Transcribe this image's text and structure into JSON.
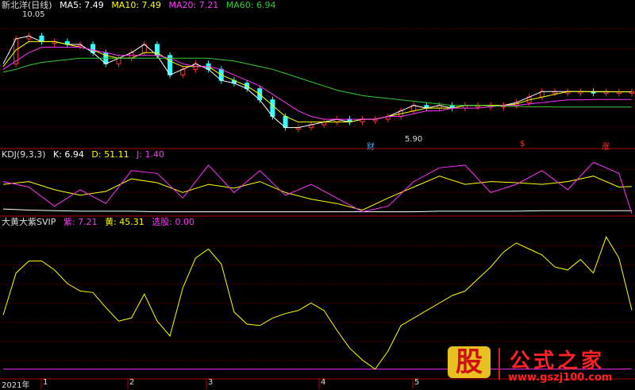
{
  "panels": {
    "main": {
      "title": "新北洋(日线)",
      "indicators": [
        {
          "label": "MA5: 7.49",
          "color": "#ffffff"
        },
        {
          "label": "MA10: 7.49",
          "color": "#ffff00"
        },
        {
          "label": "MA20: 7.21",
          "color": "#ff33ff"
        },
        {
          "label": "MA60: 6.94",
          "color": "#33cc33"
        }
      ],
      "high_label": "10.05",
      "low_label": "5.90",
      "events": [
        {
          "label": "财",
          "color": "#33aaff"
        },
        {
          "label": "$",
          "color": "#ff3333"
        },
        {
          "label": "涨",
          "color": "#ff3333"
        }
      ]
    },
    "kdj": {
      "title": "KDJ(9,3,3)",
      "indicators": [
        {
          "label": "K: 6.94",
          "color": "#ffffff"
        },
        {
          "label": "D: 51.11",
          "color": "#ffff00"
        },
        {
          "label": "J: 1.40",
          "color": "#ff33ff"
        }
      ]
    },
    "custom": {
      "title": "大黄大紫SVIP",
      "indicators": [
        {
          "label": "紫: 7.21",
          "color": "#ff33ff"
        },
        {
          "label": "黄: 45.31",
          "color": "#ffff00"
        },
        {
          "label": "选股: 0.00",
          "color": "#ff33ff"
        }
      ]
    }
  },
  "x_ticks": [
    "2021年",
    "1",
    "2",
    "3",
    "4",
    "5"
  ],
  "watermark": {
    "big": "股",
    "text": "公式之家",
    "url": "www.gszj100.com"
  },
  "colors": {
    "up": "#ff3333",
    "down": "#33ffff",
    "ma5": "#ffffff",
    "ma10": "#ffff00",
    "ma20": "#ff33ff",
    "ma60": "#33cc33",
    "sep": "#b00000",
    "grid": "#6a0000"
  },
  "chart_data": [
    {
      "type": "line",
      "panel": "main",
      "ylim": [
        5.5,
        10.4
      ],
      "x": [
        0,
        4,
        8,
        12,
        16,
        20,
        24,
        28,
        32,
        36,
        40,
        44,
        48,
        52,
        56,
        60,
        64,
        68,
        72,
        76,
        80,
        84,
        88,
        92,
        96,
        100,
        104,
        108,
        112,
        116,
        120,
        124,
        128,
        132,
        136,
        140,
        144,
        148,
        152,
        156,
        160,
        164,
        168,
        172,
        176,
        180,
        184,
        188,
        192,
        196
      ],
      "series": [
        {
          "name": "MA5",
          "values": [
            8.5,
            9.4,
            9.5,
            9.3,
            9.3,
            9.2,
            9.2,
            8.9,
            8.5,
            8.7,
            8.9,
            9.2,
            8.8,
            8.1,
            8.3,
            8.5,
            8.3,
            7.9,
            7.8,
            7.6,
            7.2,
            6.6,
            6.2,
            6.2,
            6.3,
            6.4,
            6.5,
            6.4,
            6.5,
            6.5,
            6.6,
            6.8,
            7.0,
            6.9,
            7.0,
            6.9,
            7.0,
            7.0,
            7.0,
            7.0,
            7.1,
            7.3,
            7.5,
            7.5,
            7.5,
            7.5,
            7.49,
            7.49,
            7.49,
            7.49
          ]
        },
        {
          "name": "MA10",
          "values": [
            8.4,
            9.0,
            9.3,
            9.3,
            9.3,
            9.2,
            9.1,
            9.0,
            8.8,
            8.7,
            8.7,
            8.9,
            8.9,
            8.6,
            8.4,
            8.4,
            8.4,
            8.1,
            7.9,
            7.7,
            7.4,
            7.0,
            6.6,
            6.4,
            6.4,
            6.4,
            6.4,
            6.4,
            6.5,
            6.5,
            6.6,
            6.7,
            6.8,
            6.9,
            6.9,
            6.9,
            7.0,
            7.0,
            7.0,
            7.0,
            7.05,
            7.2,
            7.3,
            7.4,
            7.5,
            7.5,
            7.5,
            7.5,
            7.49,
            7.49
          ]
        },
        {
          "name": "MA20",
          "values": [
            8.3,
            8.6,
            8.9,
            9.1,
            9.1,
            9.1,
            9.1,
            9.0,
            8.9,
            8.8,
            8.8,
            8.8,
            8.8,
            8.7,
            8.5,
            8.4,
            8.4,
            8.3,
            8.1,
            7.9,
            7.7,
            7.4,
            7.1,
            6.8,
            6.6,
            6.5,
            6.5,
            6.5,
            6.5,
            6.5,
            6.6,
            6.6,
            6.7,
            6.8,
            6.8,
            6.9,
            6.9,
            6.9,
            6.95,
            7.0,
            7.0,
            7.05,
            7.1,
            7.15,
            7.2,
            7.2,
            7.21,
            7.21,
            7.21,
            7.21
          ]
        },
        {
          "name": "MA60",
          "values": [
            8.2,
            8.3,
            8.45,
            8.55,
            8.6,
            8.65,
            8.7,
            8.7,
            8.7,
            8.7,
            8.7,
            8.7,
            8.7,
            8.7,
            8.7,
            8.7,
            8.7,
            8.65,
            8.6,
            8.5,
            8.4,
            8.3,
            8.15,
            8.0,
            7.85,
            7.7,
            7.55,
            7.45,
            7.35,
            7.3,
            7.25,
            7.2,
            7.15,
            7.1,
            7.05,
            7.0,
            7.0,
            7.0,
            6.98,
            6.97,
            6.96,
            6.95,
            6.95,
            6.94,
            6.94,
            6.94,
            6.94,
            6.94,
            6.94,
            6.94
          ]
        }
      ]
    },
    {
      "type": "line",
      "panel": "kdj",
      "ylim": [
        0,
        100
      ],
      "x": [
        0,
        8,
        16,
        24,
        32,
        40,
        48,
        56,
        64,
        72,
        80,
        88,
        96,
        104,
        112,
        120,
        128,
        136,
        144,
        152,
        160,
        168,
        176,
        184,
        192,
        196
      ],
      "series": [
        {
          "name": "K",
          "values": [
            10,
            8,
            7,
            6,
            6,
            6,
            5,
            5,
            5,
            5,
            5,
            5,
            5,
            5,
            5,
            5,
            5,
            6,
            6,
            6,
            6,
            7,
            7,
            7,
            7,
            6.94
          ]
        },
        {
          "name": "D",
          "values": [
            55,
            60,
            45,
            35,
            42,
            65,
            58,
            40,
            55,
            48,
            60,
            40,
            28,
            20,
            8,
            30,
            50,
            70,
            55,
            60,
            58,
            55,
            60,
            70,
            50,
            51.11
          ]
        },
        {
          "name": "J",
          "values": [
            60,
            50,
            15,
            45,
            20,
            80,
            75,
            30,
            90,
            40,
            80,
            35,
            55,
            30,
            5,
            15,
            60,
            85,
            90,
            40,
            55,
            80,
            45,
            95,
            75,
            1.4
          ]
        }
      ]
    },
    {
      "type": "line",
      "panel": "custom",
      "ylim": [
        0,
        100
      ],
      "x": [
        0,
        4,
        8,
        12,
        16,
        20,
        24,
        28,
        32,
        36,
        40,
        44,
        48,
        52,
        56,
        60,
        64,
        68,
        72,
        76,
        80,
        84,
        88,
        92,
        96,
        100,
        104,
        108,
        112,
        116,
        120,
        124,
        128,
        132,
        136,
        140,
        144,
        148,
        152,
        156,
        160,
        164,
        168,
        172,
        176,
        180,
        184,
        188,
        192,
        196
      ],
      "series": [
        {
          "name": "紫",
          "values": [
            6,
            6,
            6,
            6,
            6,
            6,
            6,
            6,
            6,
            6,
            6,
            6,
            6,
            6,
            6,
            6,
            6,
            6,
            6,
            6,
            6,
            6,
            6,
            6,
            6,
            6,
            6,
            6,
            6,
            6,
            6,
            6,
            6,
            6,
            6,
            6,
            6,
            6,
            6,
            6,
            6,
            6,
            6,
            6,
            6,
            6,
            6,
            6,
            6,
            6.2
          ]
        },
        {
          "name": "黄",
          "values": [
            42,
            70,
            78,
            78,
            72,
            63,
            58,
            57,
            47,
            38,
            40,
            56,
            38,
            28,
            60,
            80,
            86,
            76,
            44,
            36,
            35,
            40,
            43,
            45,
            50,
            45,
            32,
            20,
            12,
            6,
            18,
            35,
            40,
            45,
            50,
            55,
            58,
            66,
            74,
            84,
            90,
            86,
            82,
            74,
            72,
            79,
            70,
            94,
            80,
            45.31
          ]
        }
      ]
    }
  ]
}
